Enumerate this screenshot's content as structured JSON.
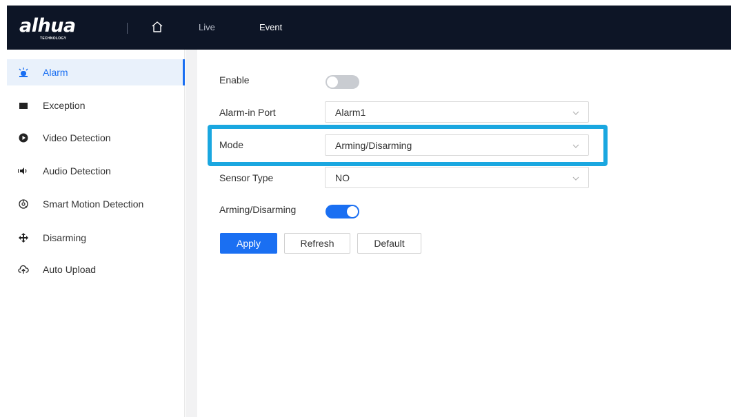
{
  "header": {
    "logo_text": "alhua",
    "logo_tagline": "TECHNOLOGY",
    "nav": [
      {
        "label": "Live"
      },
      {
        "label": "Event"
      }
    ],
    "active_nav": "Event"
  },
  "sidebar": {
    "items": [
      {
        "label": "Alarm",
        "icon": "alarm-light-icon",
        "active": true
      },
      {
        "label": "Exception",
        "icon": "exception-icon"
      },
      {
        "label": "Video Detection",
        "icon": "video-detection-icon"
      },
      {
        "label": "Audio Detection",
        "icon": "audio-detection-icon"
      },
      {
        "label": "Smart Motion Detection",
        "icon": "smart-motion-icon"
      },
      {
        "label": "Disarming",
        "icon": "disarming-icon"
      },
      {
        "label": "Auto Upload",
        "icon": "cloud-upload-icon"
      }
    ]
  },
  "form": {
    "enable_label": "Enable",
    "enable_on": false,
    "alarm_in_port_label": "Alarm-in Port",
    "alarm_in_port_value": "Alarm1",
    "mode_label": "Mode",
    "mode_value": "Arming/Disarming",
    "sensor_type_label": "Sensor Type",
    "sensor_type_value": "NO",
    "arming_label": "Arming/Disarming",
    "arming_on": true
  },
  "buttons": {
    "apply": "Apply",
    "refresh": "Refresh",
    "default": "Default"
  },
  "colors": {
    "accent": "#1a6ff2",
    "highlight": "#1aa7e0",
    "topbar": "#0d1526"
  }
}
